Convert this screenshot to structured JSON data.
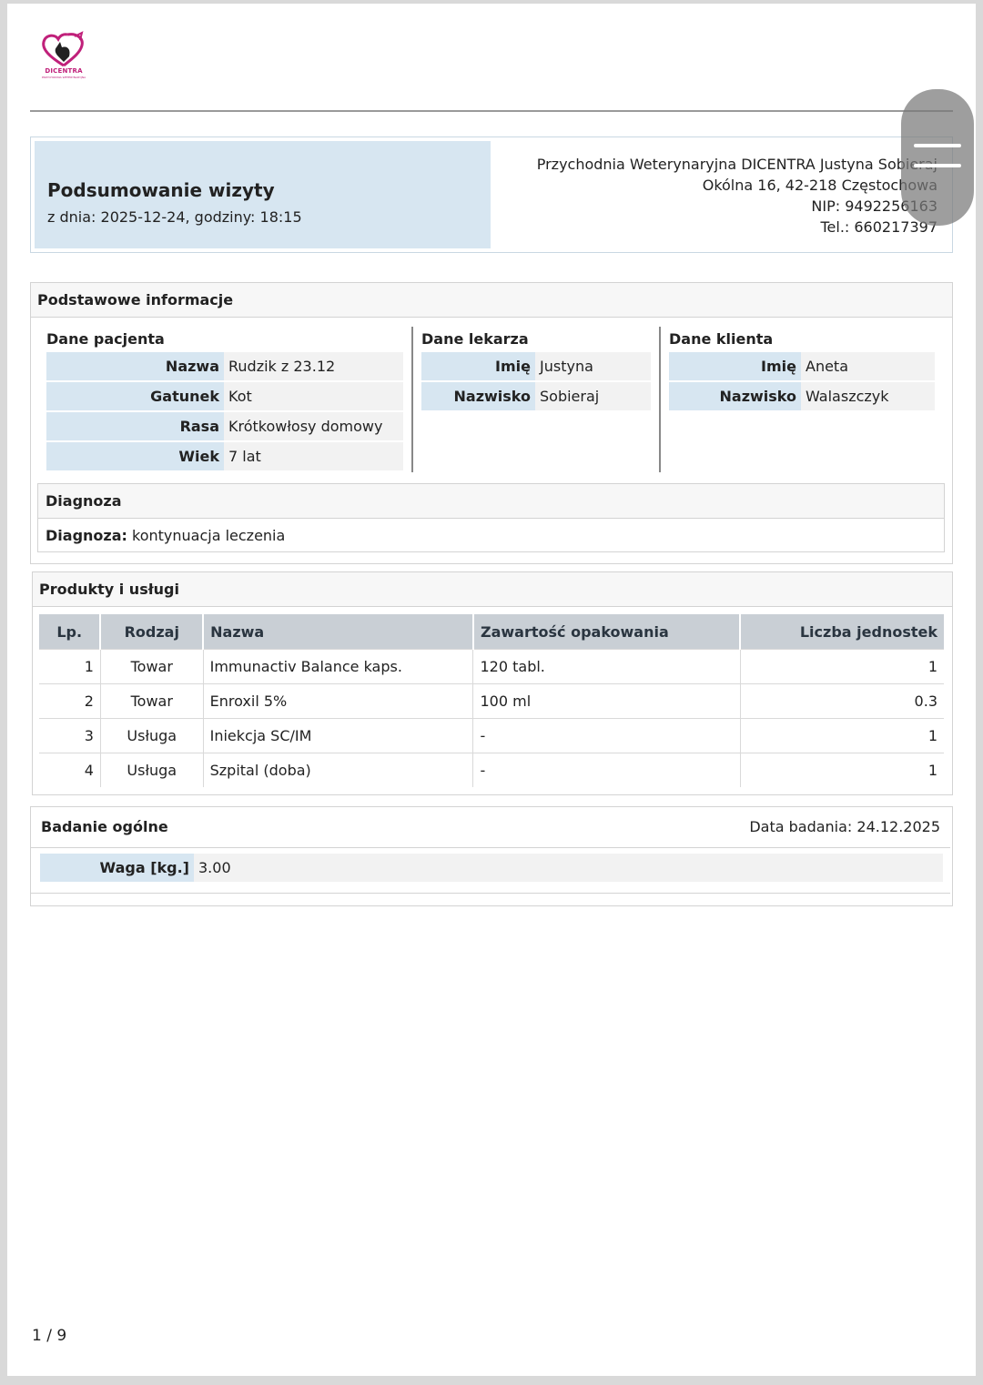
{
  "brand": {
    "name": "DICENTRA",
    "subtitle": "PRZYCHODNIA WETERYNARYJNA"
  },
  "header": {
    "title": "Podsumowanie wizyty",
    "subtitle": "z dnia: 2025-12-24, godziny: 18:15",
    "clinic_name": "Przychodnia Weterynaryjna DICENTRA Justyna Sobieraj",
    "clinic_address": "Okólna 16, 42-218 Częstochowa",
    "clinic_nip": "NIP: 9492256163",
    "clinic_tel": "Tel.: 660217397"
  },
  "basic_info": {
    "title": "Podstawowe informacje",
    "patient": {
      "title": "Dane pacjenta",
      "rows": [
        {
          "label": "Nazwa",
          "value": "Rudzik z 23.12"
        },
        {
          "label": "Gatunek",
          "value": "Kot"
        },
        {
          "label": "Rasa",
          "value": "Krótkowłosy domowy"
        },
        {
          "label": "Wiek",
          "value": "7 lat"
        }
      ]
    },
    "doctor": {
      "title": "Dane lekarza",
      "rows": [
        {
          "label": "Imię",
          "value": "Justyna"
        },
        {
          "label": "Nazwisko",
          "value": "Sobieraj"
        }
      ]
    },
    "client": {
      "title": "Dane klienta",
      "rows": [
        {
          "label": "Imię",
          "value": "Aneta"
        },
        {
          "label": "Nazwisko",
          "value": "Walaszczyk"
        }
      ]
    },
    "diagnosis": {
      "title": "Diagnoza",
      "label": "Diagnoza:",
      "value": "kontynuacja leczenia"
    }
  },
  "products": {
    "title": "Produkty i usługi",
    "columns": [
      "Lp.",
      "Rodzaj",
      "Nazwa",
      "Zawartość opakowania",
      "Liczba jednostek"
    ],
    "rows": [
      [
        "1",
        "Towar",
        "Immunactiv Balance kaps.",
        "120 tabl.",
        "1"
      ],
      [
        "2",
        "Towar",
        "Enroxil 5%",
        "100 ml",
        "0.3"
      ],
      [
        "3",
        "Usługa",
        "Iniekcja SC/IM",
        "-",
        "1"
      ],
      [
        "4",
        "Usługa",
        "Szpital (doba)",
        "-",
        "1"
      ]
    ]
  },
  "exam": {
    "title": "Badanie ogólne",
    "date": "Data badania: 24.12.2025",
    "weight_label": "Waga [kg.]",
    "weight_value": "3.00"
  },
  "footer": {
    "page": "1 / 9"
  },
  "colors": {
    "label_bg": "#d7e6f1",
    "value_bg": "#f2f2f2",
    "table_head_bg": "#c9cfd5",
    "logo": "#c0207a"
  }
}
